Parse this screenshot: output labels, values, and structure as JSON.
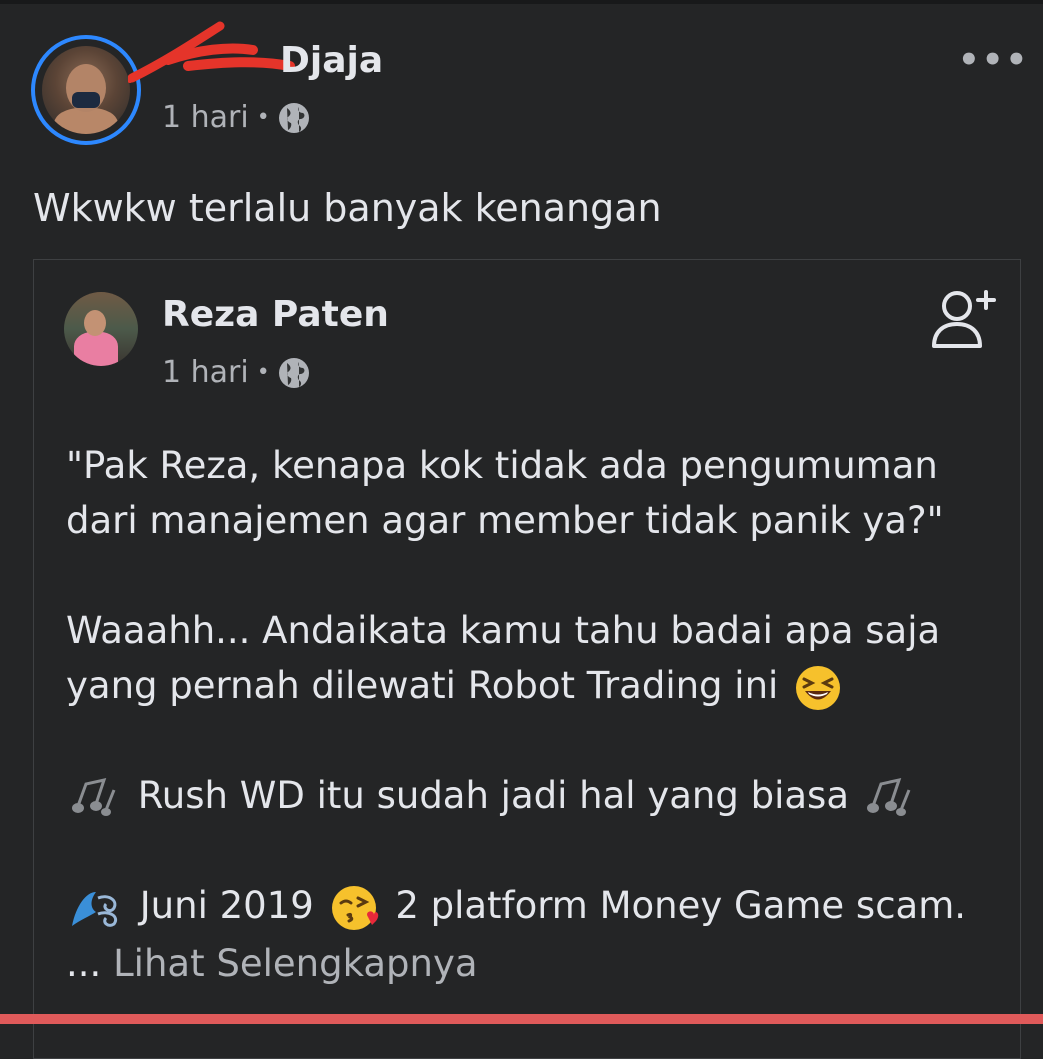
{
  "post": {
    "author_name": "Djaja",
    "time": "1 hari",
    "separator": "•",
    "privacy_icon": "globe-icon",
    "more_icon": "more-horizontal-icon",
    "more_label": "•••",
    "text": "Wkwkw terlalu banyak kenangan"
  },
  "shared_post": {
    "author_name": "Reza Paten",
    "time": "1 hari",
    "separator": "•",
    "privacy_icon": "globe-icon",
    "add_friend_icon": "add-friend-icon",
    "lines": {
      "line1": "\"Pak Reza, kenapa kok tidak ada pengumuman",
      "line2": "dari manajemen agar member tidak panik ya?\"",
      "line3": "Waaahh... Andaikata kamu tahu badai apa saja",
      "line4": "yang pernah dilewati Robot Trading ini",
      "line5": "Rush WD itu sudah jadi hal yang biasa",
      "line6_a": "Juni 2019",
      "line6_b": "2 platform Money Game scam."
    },
    "see_more_ellipsis": "...",
    "see_more": "Lihat Selengkapnya"
  },
  "colors": {
    "background": "#242526",
    "text_primary": "#e4e6eb",
    "text_secondary": "#b0b3b8",
    "avatar_ring": "#2d88ff",
    "redaction": "#e5342a"
  }
}
